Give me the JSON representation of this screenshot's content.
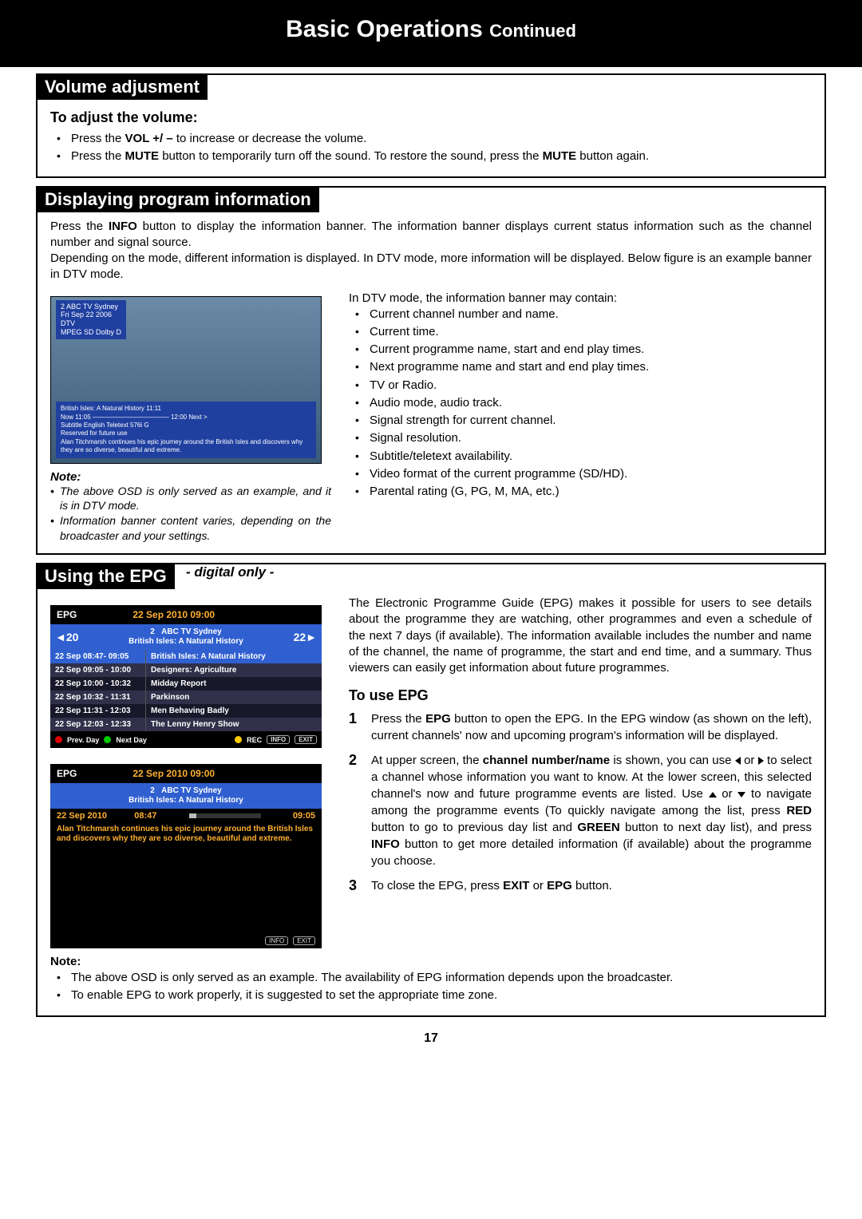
{
  "header": {
    "main": "Basic Operations ",
    "sub": "Continued"
  },
  "volume": {
    "title": "Volume adjusment",
    "subtitle": "To adjust the volume:",
    "b1_pre": "Press the ",
    "b1_bold": "VOL +/ –",
    "b1_post": "  to increase or decrease the volume.",
    "b2_pre": "Press the ",
    "b2_bold1": "MUTE",
    "b2_mid": " button to temporarily turn off the sound.  To restore the sound, press the ",
    "b2_bold2": "MUTE",
    "b2_post": " button again."
  },
  "info": {
    "title": "Displaying program information",
    "p1_pre": "Press the ",
    "p1_bold": "INFO",
    "p1_post": " button to display the information banner. The information banner displays current status information such as the channel number and signal source.",
    "p2": "Depending on the mode, different information is displayed. In DTV mode, more information will be displayed. Below figure is an example banner in DTV mode.",
    "banner_top1": "2    ABC TV Sydney",
    "banner_top2": "Fri Sep 22 2006",
    "banner_top3": "DTV",
    "banner_top4": "MPEG SD Dolby D",
    "banner_b_title": "British Isles: A Natural History                                                    11:11",
    "banner_b_time": "Now          11:05 ———————————— 12:00          Next  >",
    "banner_b_row2": "Subtitle   English          Teletext      576i      G",
    "banner_b_row3": "Reserved for future use",
    "banner_b_row4": "Alan Titchmarsh continues his epic journey around the British Isles and discovers why they are so diverse, beautiful and extreme.",
    "note_label": "Note:",
    "note1": "The above OSD is only served as an example, and it is in DTV mode.",
    "note2": "Information banner content varies, depending on the broadcaster and your settings.",
    "intro": "In DTV mode, the information banner may contain:",
    "items": [
      "Current channel number and name.",
      "Current time.",
      "Current programme name, start and end play times.",
      "Next programme name and start and end play times.",
      "TV or Radio.",
      "Audio mode, audio track.",
      "Signal strength for current channel.",
      "Signal resolution.",
      "Subtitle/teletext availability.",
      "Video format of the current programme (SD/HD).",
      "Parental rating (G, PG, M, MA, etc.)"
    ]
  },
  "epg": {
    "title": "Using the EPG",
    "digital": "- digital only -",
    "intro": "The Electronic Programme Guide (EPG) makes it possible for users to see details about the programme they are watching, other programmes and even a schedule of the next 7 days (if available). The information available includes the number and name of the channel, the name of programme, the start and end time, and a summary. Thus viewers can easily get information about future programmes.",
    "to_use": "To use EPG",
    "step1_pre": "Press the ",
    "step1_b1": "EPG",
    "step1_post": " button to open the EPG. In the EPG window (as shown on the left), current channels' now and upcoming program's information will be displayed.",
    "step2_pre": "At upper screen, the ",
    "step2_b1": "channel number/name",
    "step2_mid1": " is shown, you can use ",
    "step2_mid2": " or ",
    "step2_mid3": " to select a channel whose information you want to know. At the lower screen, this selected channel's now and future programme events are listed. Use ",
    "step2_mid4": " or ",
    "step2_mid5": "  to navigate among the programme events (To quickly navigate among the list, press ",
    "step2_b2": "RED",
    "step2_mid6": " button to go to previous day list and ",
    "step2_b3": "GREEN",
    "step2_mid7": " button to next day list), and press ",
    "step2_b4": "INFO",
    "step2_post": " button to get more detailed information (if available) about the programme you choose.",
    "step3_pre": "To close the EPG, press ",
    "step3_b1": "EXIT",
    "step3_mid": " or ",
    "step3_b2": "EPG",
    "step3_post": " button.",
    "note_label": "Note:",
    "noteA": "The above OSD is only served as an example. The availability of EPG information depends upon the broadcaster.",
    "noteB": "To enable EPG to work properly, it is suggested to set the appropriate time zone.",
    "osd1": {
      "label": "EPG",
      "date": "22 Sep 2010   09:00",
      "chL": "20",
      "chNum": "2",
      "chName": "ABC  TV Sydney",
      "chProg": "British Isles: A Natural History",
      "chR": "22",
      "rows": [
        {
          "t": "22 Sep  08:47- 09:05",
          "p": "British Isles: A Natural History"
        },
        {
          "t": "22 Sep  09:05 - 10:00",
          "p": "Designers: Agriculture"
        },
        {
          "t": "22 Sep  10:00 - 10:32",
          "p": "Midday Report"
        },
        {
          "t": "22 Sep  10:32 - 11:31",
          "p": "Parkinson"
        },
        {
          "t": "22 Sep  11:31 - 12:03",
          "p": "Men Behaving Badly"
        },
        {
          "t": "22 Sep  12:03 - 12:33",
          "p": "The Lenny Henry Show"
        }
      ],
      "prev": "Prev. Day",
      "next": "Next Day",
      "rec": "REC",
      "info": "INFO",
      "exit": "EXIT"
    },
    "osd2": {
      "label": "EPG",
      "date": "22 Sep 2010   09:00",
      "chNum": "2",
      "chName": "ABC  TV Sydney",
      "chProg": "British Isles: A Natural History",
      "pdate": "22 Sep 2010",
      "pstart": "08:47",
      "pend": "09:05",
      "desc": "Alan Titchmarsh continues his epic journey around the British Isles and discovers why they are so diverse, beautiful and extreme.",
      "info": "INFO",
      "exit": "EXIT"
    }
  },
  "page_number": "17"
}
